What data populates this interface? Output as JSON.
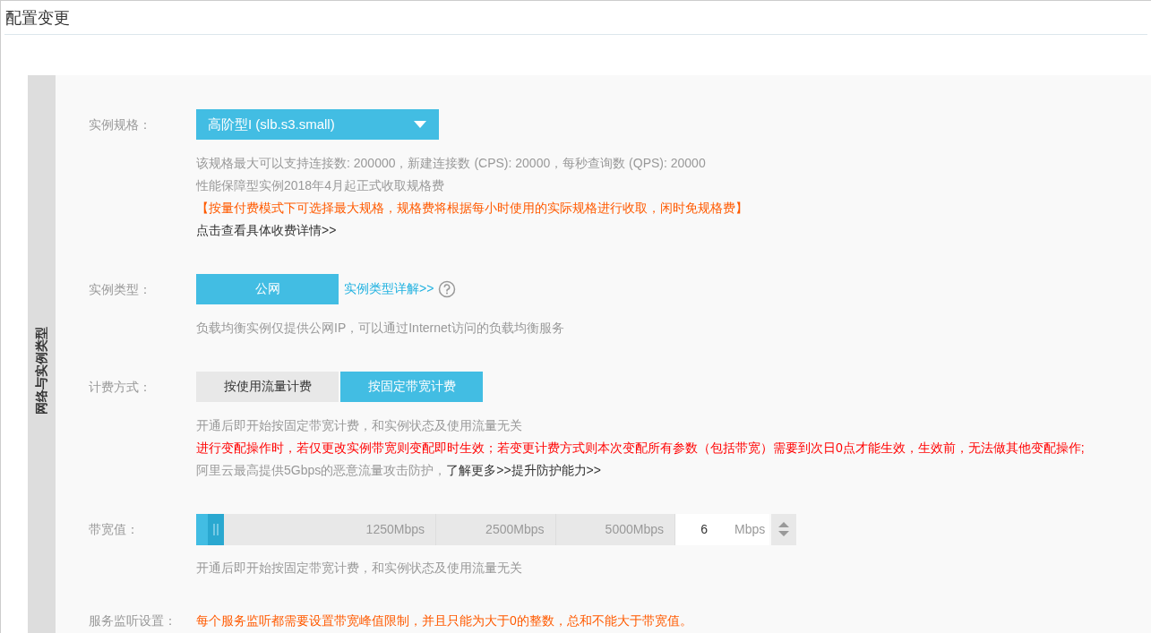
{
  "title": "配置变更",
  "section": {
    "title": "网络与实例类型",
    "rows": [
      {
        "kind": "dropdown",
        "label": "实例规格：",
        "value": "高阶型I (slb.s3.small)",
        "notes": [
          {
            "color": "#999999",
            "text": "该规格最大可以支持连接数: 200000，新建连接数 (CPS): 20000，每秒查询数 (QPS): 20000"
          },
          {
            "color": "#999999",
            "text": "性能保障型实例2018年4月起正式收取规格费"
          },
          {
            "color": "#ff5a00",
            "text": "【按量付费模式下可选择最大规格，规格费将根据每小时使用的实际规格进行收取，闲时免规格费】"
          }
        ],
        "footer_link": "点击查看具体收费详情>>"
      },
      {
        "kind": "options",
        "label": "实例类型：",
        "options": [
          {
            "label": "公网",
            "selected": true
          }
        ],
        "link": "实例类型详解>>",
        "notes": [
          {
            "color": "#999999",
            "text": "负载均衡实例仅提供公网IP，可以通过Internet访问的负载均衡服务"
          }
        ]
      },
      {
        "kind": "options",
        "label": "计费方式：",
        "options": [
          {
            "label": "按使用流量计费",
            "selected": false
          },
          {
            "label": "按固定带宽计费",
            "selected": true
          }
        ],
        "notes": [
          {
            "color": "#999999",
            "text": "开通后即开始按固定带宽计费，和实例状态及使用流量无关"
          },
          {
            "color": "#ff0000",
            "text": "进行变配操作时，若仅更改实例带宽则变配即时生效；若变更计费方式则本次变配所有参数（包括带宽）需要到次日0点才能生效，生效前，无法做其他变配操作;"
          },
          {
            "color": "#999999",
            "text": "阿里云最高提供5Gbps的恶意流量攻击防护，",
            "links": [
              "了解更多>>",
              "提升防护能力>>"
            ]
          }
        ]
      },
      {
        "kind": "slider",
        "label": "带宽值：",
        "level": 0.0012,
        "marks": [
          "1250Mbps",
          "2500Mbps",
          "5000Mbps"
        ],
        "value": "6",
        "unit": "Mbps",
        "notes": [
          {
            "color": "#999999",
            "text": "开通后即开始按固定带宽计费，和实例状态及使用流量无关"
          }
        ]
      },
      {
        "kind": "text",
        "label": "服务监听设置：",
        "color": "#ff5a00",
        "text": "每个服务监听都需要设置带宽峰值限制，并且只能为大于0的整数，总和不能大于带宽值。"
      }
    ]
  }
}
